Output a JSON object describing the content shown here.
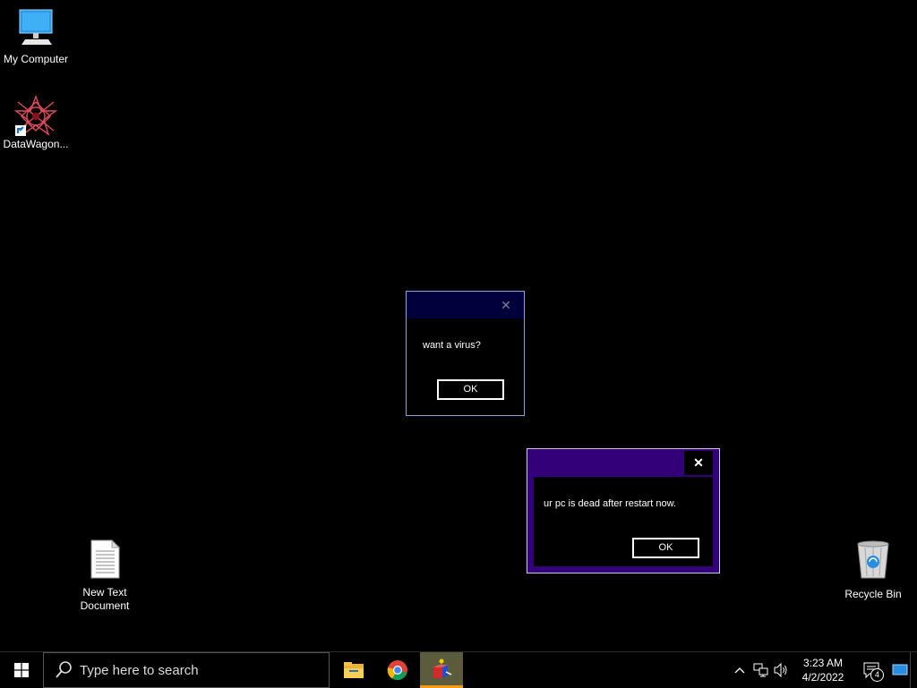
{
  "desktop": {
    "icons": [
      {
        "label": "My Computer",
        "icon": "computer-icon"
      },
      {
        "label": "DataWagon...",
        "icon": "datawagon-shortcut-icon"
      },
      {
        "label": "New Text Document",
        "icon": "text-document-icon"
      },
      {
        "label": "Recycle Bin",
        "icon": "recycle-bin-icon"
      }
    ]
  },
  "dialogs": [
    {
      "message": "want a virus?",
      "ok_label": "OK",
      "close_glyph": "✕",
      "title_color": "#00003c"
    },
    {
      "message": "ur pc is dead after restart now.",
      "ok_label": "OK",
      "close_glyph": "✕",
      "title_color": "#33007a"
    }
  ],
  "taskbar": {
    "search_placeholder": "Type here to search",
    "pinned_apps": [
      {
        "name": "file-explorer",
        "icon": "folder-icon",
        "active": false
      },
      {
        "name": "chrome",
        "icon": "chrome-icon",
        "active": false
      },
      {
        "name": "running-app",
        "icon": "cube-app-icon",
        "active": true
      }
    ],
    "tray": {
      "chevron": "^",
      "clock_time": "3:23 AM",
      "clock_date": "4/2/2022",
      "notification_count": "4"
    },
    "accent_color": "#f39c12"
  }
}
